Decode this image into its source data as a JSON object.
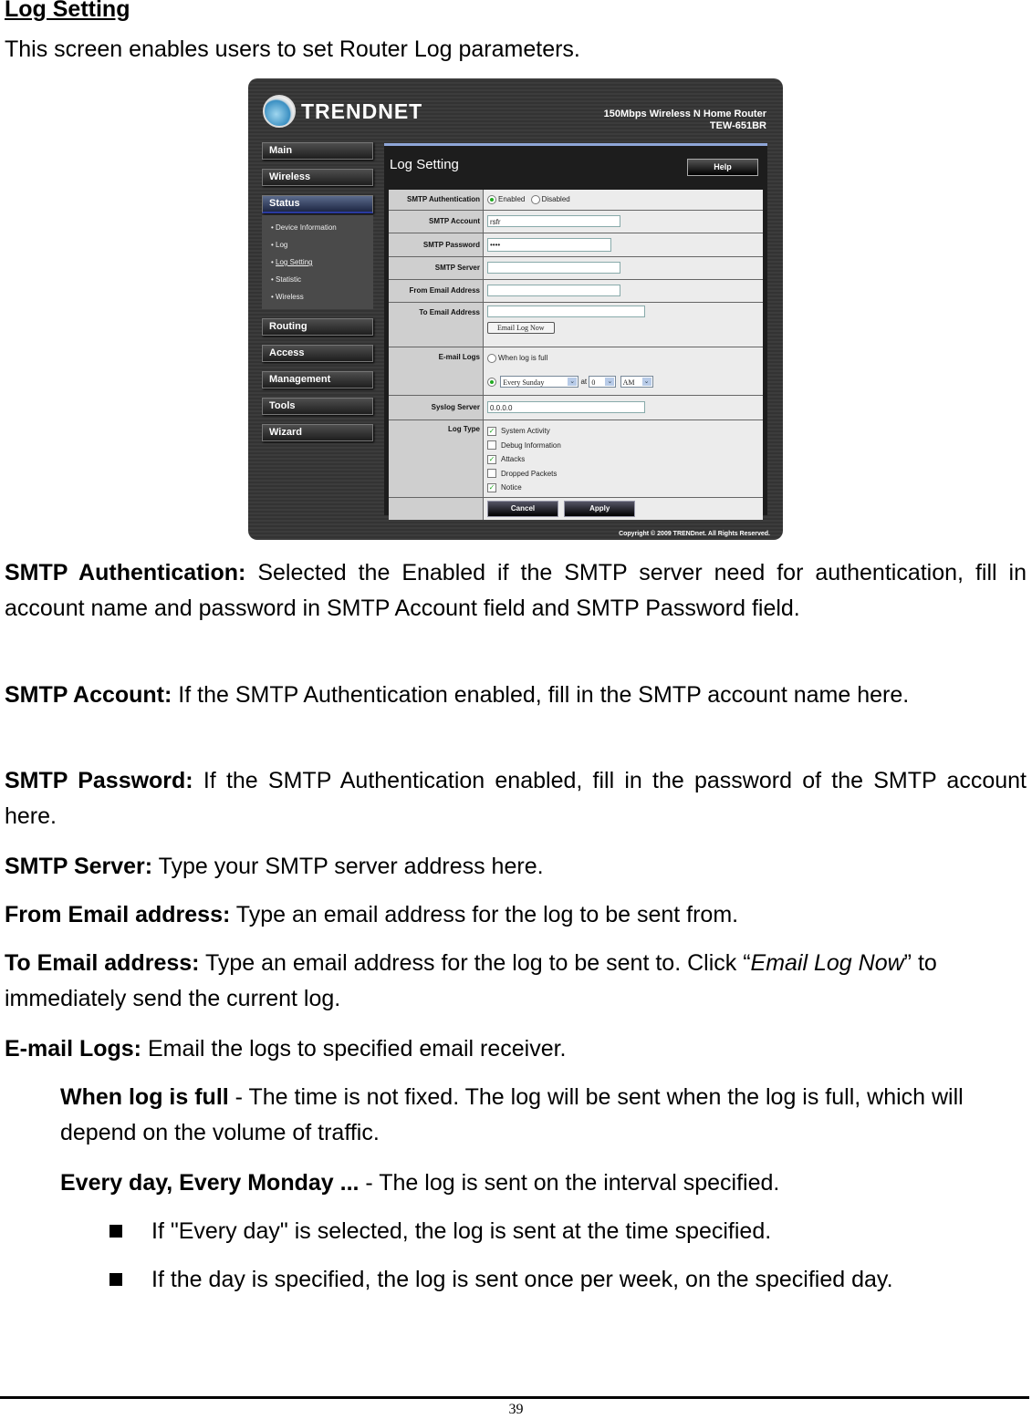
{
  "heading": "Log Setting",
  "intro": "This screen enables users to set Router Log parameters.",
  "router": {
    "brand": "TRENDNET",
    "model_line1": "150Mbps Wireless N Home Router",
    "model_line2": "TEW-651BR",
    "nav": [
      {
        "label": "Main"
      },
      {
        "label": "Wireless"
      },
      {
        "label": "Status",
        "active": true
      },
      {
        "label": "Routing"
      },
      {
        "label": "Access"
      },
      {
        "label": "Management"
      },
      {
        "label": "Tools"
      },
      {
        "label": "Wizard"
      }
    ],
    "status_sub": [
      "Device Information",
      "Log",
      "Log Setting",
      "Statistic",
      "Wireless"
    ],
    "page_title": "Log Setting",
    "help_label": "Help",
    "form": {
      "smtp_auth_label": "SMTP Authentication",
      "smtp_auth_enabled": "Enabled",
      "smtp_auth_disabled": "Disabled",
      "smtp_account_label": "SMTP Account",
      "smtp_account_value": "rsfr",
      "smtp_password_label": "SMTP Password",
      "smtp_password_value": "••••",
      "smtp_server_label": "SMTP Server",
      "smtp_server_value": "",
      "from_label": "From Email Address",
      "from_value": "",
      "to_label": "To Email Address",
      "to_value": "",
      "email_log_now": "Email Log Now",
      "email_logs_label": "E-mail Logs",
      "when_full": "When log is full",
      "schedule_day": "Every Sunday",
      "at_label": "at",
      "schedule_hour": "0",
      "schedule_ampm": "AM",
      "syslog_label": "Syslog Server",
      "syslog_value": "0.0.0.0",
      "log_type_label": "Log Type",
      "log_types": [
        {
          "label": "System Activity",
          "checked": true
        },
        {
          "label": "Debug Information",
          "checked": false
        },
        {
          "label": "Attacks",
          "checked": true
        },
        {
          "label": "Dropped Packets",
          "checked": false
        },
        {
          "label": "Notice",
          "checked": true
        }
      ],
      "cancel": "Cancel",
      "apply": "Apply"
    },
    "copyright": "Copyright © 2009 TRENDnet. All Rights Reserved."
  },
  "paragraphs": {
    "smtp_auth_term": "SMTP Authentication:",
    "smtp_auth_text": " Selected the Enabled if the SMTP server need for authentication, fill in account name and password in SMTP Account field and SMTP Password field.",
    "smtp_account_term": "SMTP Account:",
    "smtp_account_text": " If the SMTP Authentication enabled, fill in the SMTP account name here.",
    "smtp_password_term": "SMTP Password:",
    "smtp_password_text": " If the SMTP Authentication enabled, fill in the password of the SMTP account here.",
    "smtp_server_term": "SMTP Server:",
    "smtp_server_text": " Type your SMTP server address here.",
    "from_term": "From Email address:",
    "from_text": " Type an email address for the log to be sent from.",
    "to_term": "To Email address:",
    "to_text_1": " Type an email address for the log to be sent to. Click “",
    "to_italic": "Email Log Now",
    "to_text_2": "” to immediately send the current log.",
    "email_logs_term": "E-mail Logs:",
    "email_logs_text": " Email the logs to specified email receiver.",
    "when_full_term": "When log is full",
    "when_full_text": " - The time is not fixed. The log will be sent when the log is full, which will depend on the volume of traffic.",
    "every_day_term": "Every day, Every Monday ...",
    "every_day_text": "  - The log is sent on the interval specified.",
    "bullets": [
      "If \"Every day\" is selected, the log is sent at the time specified.",
      "If the day is specified, the log is sent once per week, on the specified day."
    ]
  },
  "page_number": "39"
}
